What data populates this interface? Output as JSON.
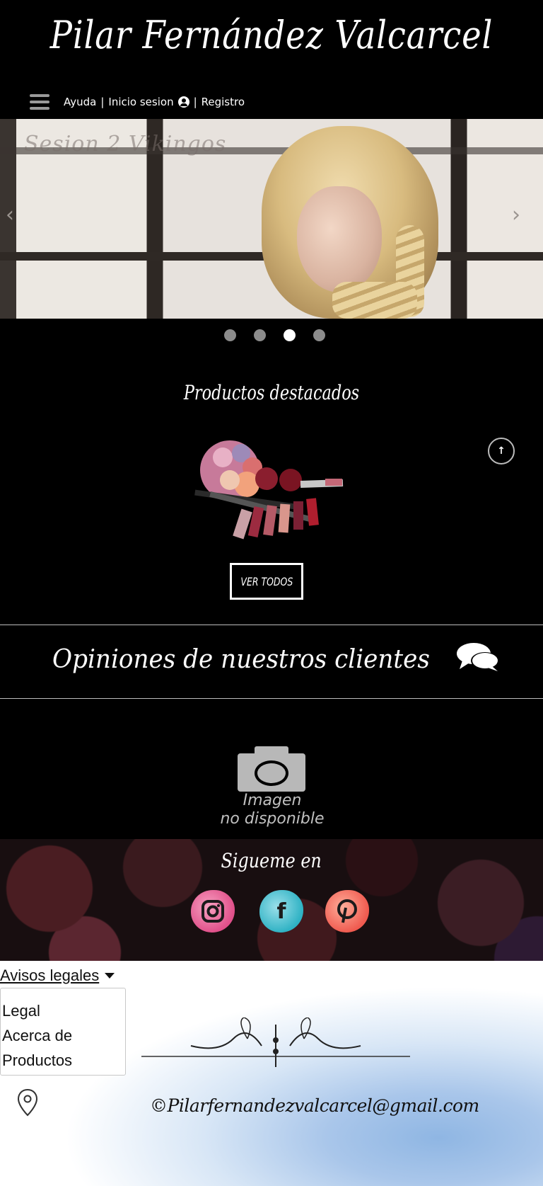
{
  "header": {
    "brand": "Pilar Fernández Valcarcel",
    "nav": {
      "help": "Ayuda",
      "login": "Inicio sesion",
      "register": "Registro",
      "separator": "|"
    }
  },
  "carousel": {
    "caption": "Sesion 2 Vikingos",
    "prev_glyph": "‹",
    "next_glyph": "›",
    "slide_count": 4,
    "active_index": 3
  },
  "featured": {
    "title": "Productos destacados",
    "view_all": "VER TODOS",
    "scroll_top_glyph": "↑"
  },
  "opinions": {
    "title": "Opiniones de nuestros clientes",
    "no_image_line1": "Imagen",
    "no_image_line2": "no disponible"
  },
  "social": {
    "title": "Sigueme en",
    "networks": [
      "instagram",
      "facebook",
      "pinterest"
    ]
  },
  "footer": {
    "legal_toggle": "Avisos legales",
    "legal_items": [
      "Legal",
      "Acerca de",
      "Productos"
    ],
    "email": "©Pilarfernandezvalcarcel@gmail.com"
  }
}
